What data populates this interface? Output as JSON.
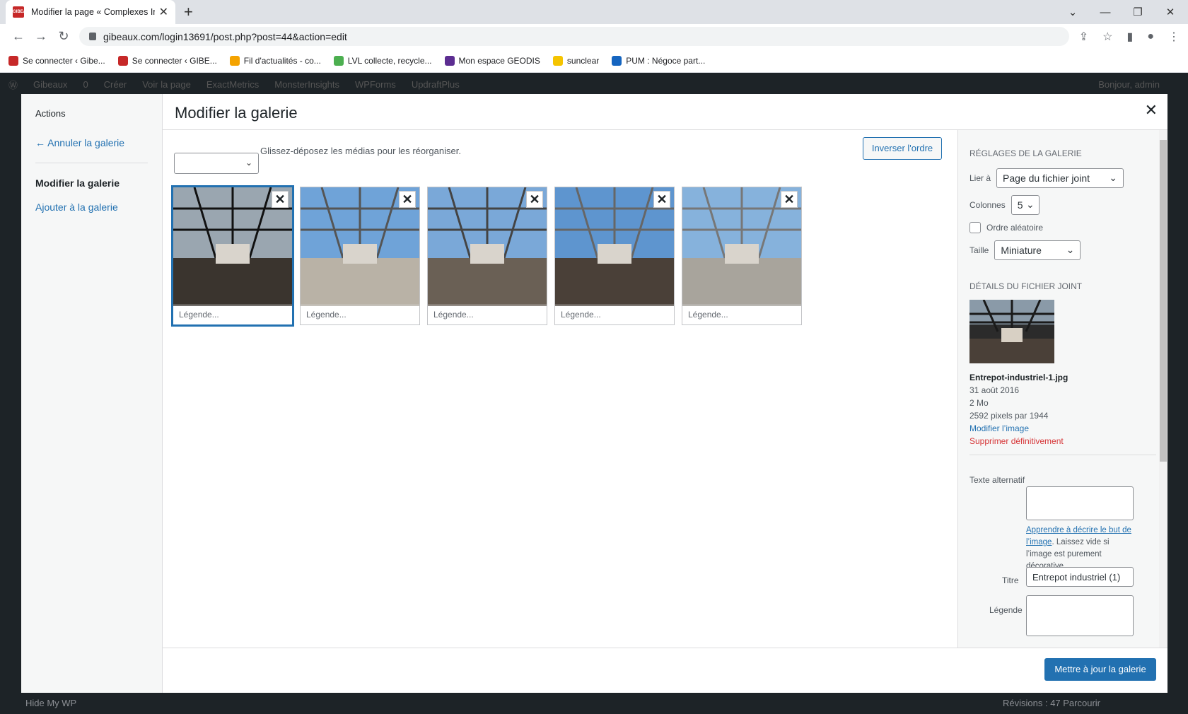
{
  "browser": {
    "tab_title": "Modifier la page « Complexes Ind",
    "tab_favicon_text": "GIBEAUX",
    "url": "gibeaux.com/login13691/post.php?post=44&action=edit",
    "bookmarks": [
      {
        "label": "Se connecter ‹ Gibe...",
        "color": "#c62828"
      },
      {
        "label": "Se connecter ‹ GIBE...",
        "color": "#c62828"
      },
      {
        "label": "Fil d'actualités - co...",
        "color": "#f4a300"
      },
      {
        "label": "LVL collecte, recycle...",
        "color": "#4caf50"
      },
      {
        "label": "Mon espace GEODIS",
        "color": "#5c2d91"
      },
      {
        "label": "sunclear",
        "color": "#f5c400"
      },
      {
        "label": "PUM : Négoce part...",
        "color": "#1565c0"
      }
    ]
  },
  "wp_admin_bar": {
    "items": [
      "Gibeaux",
      "0",
      "Créer",
      "Voir la page",
      "ExactMetrics",
      "MonsterInsights",
      "WPForms",
      "UpdraftPlus"
    ],
    "greeting": "Bonjour, admin",
    "bottom_left": "Hide My WP",
    "bottom_right": "Révisions : 47 Parcourir"
  },
  "modal": {
    "title": "Modifier la galerie",
    "menu": {
      "heading": "Actions",
      "cancel": "← Annuler la galerie",
      "edit": "Modifier la galerie",
      "add": "Ajouter à la galerie"
    },
    "instructions": "Glissez-déposez les médias pour les réorganiser.",
    "reverse_button": "Inverser l'ordre",
    "caption_placeholder": "Légende...",
    "images": [
      {
        "name": "Entrepot-industriel-1.jpg",
        "selected": true
      },
      {
        "name": "image-2",
        "selected": false
      },
      {
        "name": "image-3",
        "selected": false
      },
      {
        "name": "image-4",
        "selected": false
      },
      {
        "name": "image-5",
        "selected": false
      }
    ],
    "settings": {
      "heading": "Réglages de la galerie",
      "link_label": "Lier à",
      "link_value": "Page du fichier joint",
      "columns_label": "Colonnes",
      "columns_value": "5",
      "random_label": "Ordre aléatoire",
      "size_label": "Taille",
      "size_value": "Miniature"
    },
    "details": {
      "heading": "Détails du fichier joint",
      "filename": "Entrepot-industriel-1.jpg",
      "date": "31 août 2016",
      "size": "2 Mo",
      "dimensions": "2592 pixels par 1944",
      "edit_link": "Modifier l’image",
      "delete_link": "Supprimer définitivement",
      "alt_label": "Texte alternatif",
      "alt_hint_link": "Apprendre à décrire le but de l’image",
      "alt_hint_rest": ". Laissez vide si l’image est purement décorative.",
      "title_label": "Titre",
      "title_value": "Entrepot industriel  (1)",
      "caption_label": "Légende"
    },
    "update_button": "Mettre à jour la galerie"
  }
}
